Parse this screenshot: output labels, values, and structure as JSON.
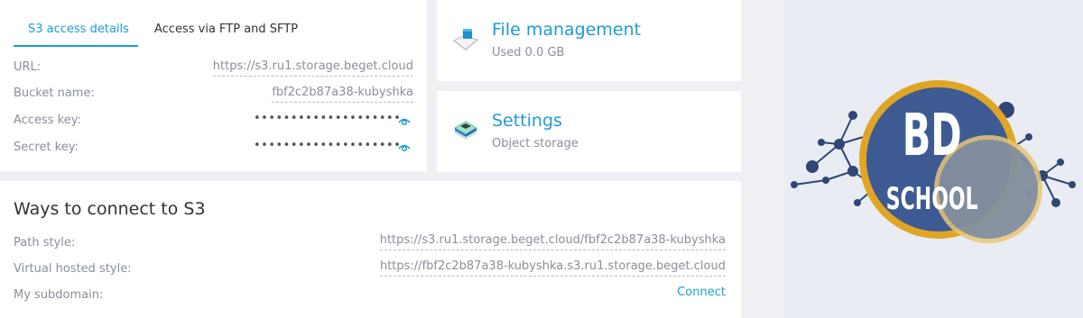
{
  "access": {
    "tabs": [
      {
        "label": "S3 access details",
        "active": true
      },
      {
        "label": "Access via FTP and SFTP",
        "active": false
      }
    ],
    "rows": [
      {
        "label": "URL:",
        "value": "https://s3.ru1.storage.beget.cloud"
      },
      {
        "label": "Bucket name:",
        "value": "fbf2c2b87a38-kubyshka"
      },
      {
        "label": "Access key:",
        "value": "••••••••••••••••••••"
      },
      {
        "label": "Secret key:",
        "value": "••••••••••••••••••••"
      }
    ]
  },
  "files": {
    "title": "File management",
    "subtitle": "Used 0.0 GB"
  },
  "settings": {
    "title": "Settings",
    "subtitle": "Object storage"
  },
  "ways": {
    "title": "Ways to connect to S3",
    "rows": [
      {
        "label": "Path style:",
        "value": "https://s3.ru1.storage.beget.cloud/fbf2c2b87a38-kubyshka"
      },
      {
        "label": "Virtual hosted style:",
        "value": "https://fbf2c2b87a38-kubyshka.s3.ru1.storage.beget.cloud"
      },
      {
        "label": "My subdomain:",
        "value": "Connect"
      }
    ]
  },
  "logo": {
    "line1": "BD",
    "line2": "SCHOOL"
  },
  "colors": {
    "accent": "#1e9bd7",
    "muted": "#8a8f99",
    "background": "#eef0f4",
    "logo_blue": "#3d5a93",
    "logo_gold": "#e0a526"
  }
}
